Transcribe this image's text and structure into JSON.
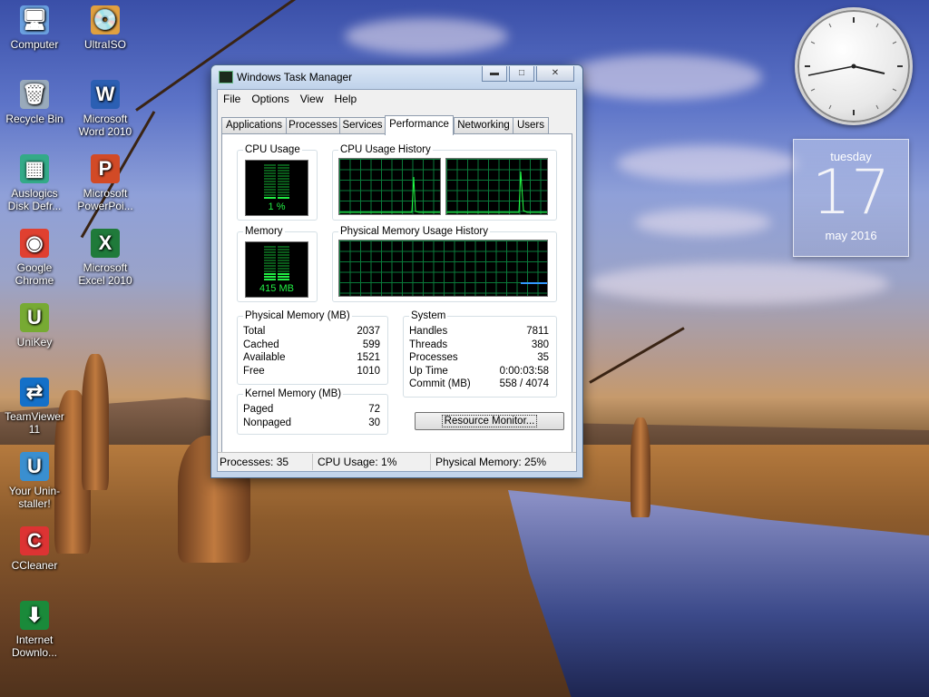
{
  "desktop": {
    "icons": [
      {
        "label": "Computer",
        "glyph": "🖥"
      },
      {
        "label": "UltraISO",
        "glyph": "💿"
      },
      {
        "label": "Recycle Bin",
        "glyph": "🗑"
      },
      {
        "label": "Microsoft Word 2010",
        "glyph": "W"
      },
      {
        "label": "Auslogics Disk Defr...",
        "glyph": "▦"
      },
      {
        "label": "Microsoft PowerPoi...",
        "glyph": "P"
      },
      {
        "label": "Google Chrome",
        "glyph": "◉"
      },
      {
        "label": "Microsoft Excel 2010",
        "glyph": "X"
      },
      {
        "label": "UniKey",
        "glyph": "U"
      },
      {
        "label": "TeamViewer 11",
        "glyph": "⇄"
      },
      {
        "label": "Your Unin-staller!",
        "glyph": "U"
      },
      {
        "label": "CCleaner",
        "glyph": "C"
      },
      {
        "label": "Internet Downlo...",
        "glyph": "⬇"
      }
    ]
  },
  "calendar": {
    "weekday": "tuesday",
    "day": "17",
    "month_year": "may 2016"
  },
  "window": {
    "title": "Windows Task Manager",
    "controls": {
      "minimize": "▬",
      "maximize": "□",
      "close": "✕"
    },
    "menu": [
      "File",
      "Options",
      "View",
      "Help"
    ],
    "tabs": [
      "Applications",
      "Processes",
      "Services",
      "Performance",
      "Networking",
      "Users"
    ],
    "active_tab": "Performance"
  },
  "performance": {
    "cpu_usage_label": "CPU Usage",
    "cpu_usage_value": "1 %",
    "cpu_usage_percent": 1,
    "cpu_history_label": "CPU Usage History",
    "memory_label": "Memory",
    "memory_value": "415 MB",
    "memory_percent": 25,
    "phys_history_label": "Physical Memory Usage History",
    "physical_memory": {
      "title": "Physical Memory (MB)",
      "rows": [
        {
          "k": "Total",
          "v": "2037"
        },
        {
          "k": "Cached",
          "v": "599"
        },
        {
          "k": "Available",
          "v": "1521"
        },
        {
          "k": "Free",
          "v": "1010"
        }
      ]
    },
    "kernel_memory": {
      "title": "Kernel Memory (MB)",
      "rows": [
        {
          "k": "Paged",
          "v": "72"
        },
        {
          "k": "Nonpaged",
          "v": "30"
        }
      ]
    },
    "system": {
      "title": "System",
      "rows": [
        {
          "k": "Handles",
          "v": "7811"
        },
        {
          "k": "Threads",
          "v": "380"
        },
        {
          "k": "Processes",
          "v": "35"
        },
        {
          "k": "Up Time",
          "v": "0:00:03:58"
        },
        {
          "k": "Commit (MB)",
          "v": "558 / 4074"
        }
      ]
    },
    "resource_monitor_button": "Resource Monitor..."
  },
  "status": {
    "processes": "Processes: 35",
    "cpu": "CPU Usage: 1%",
    "memory": "Physical Memory: 25%"
  },
  "colors": {
    "graph_line": "#22ff44",
    "memory_line": "#3399ff",
    "meter_on": "#22ee44",
    "meter_off": "#0a5a1a"
  }
}
